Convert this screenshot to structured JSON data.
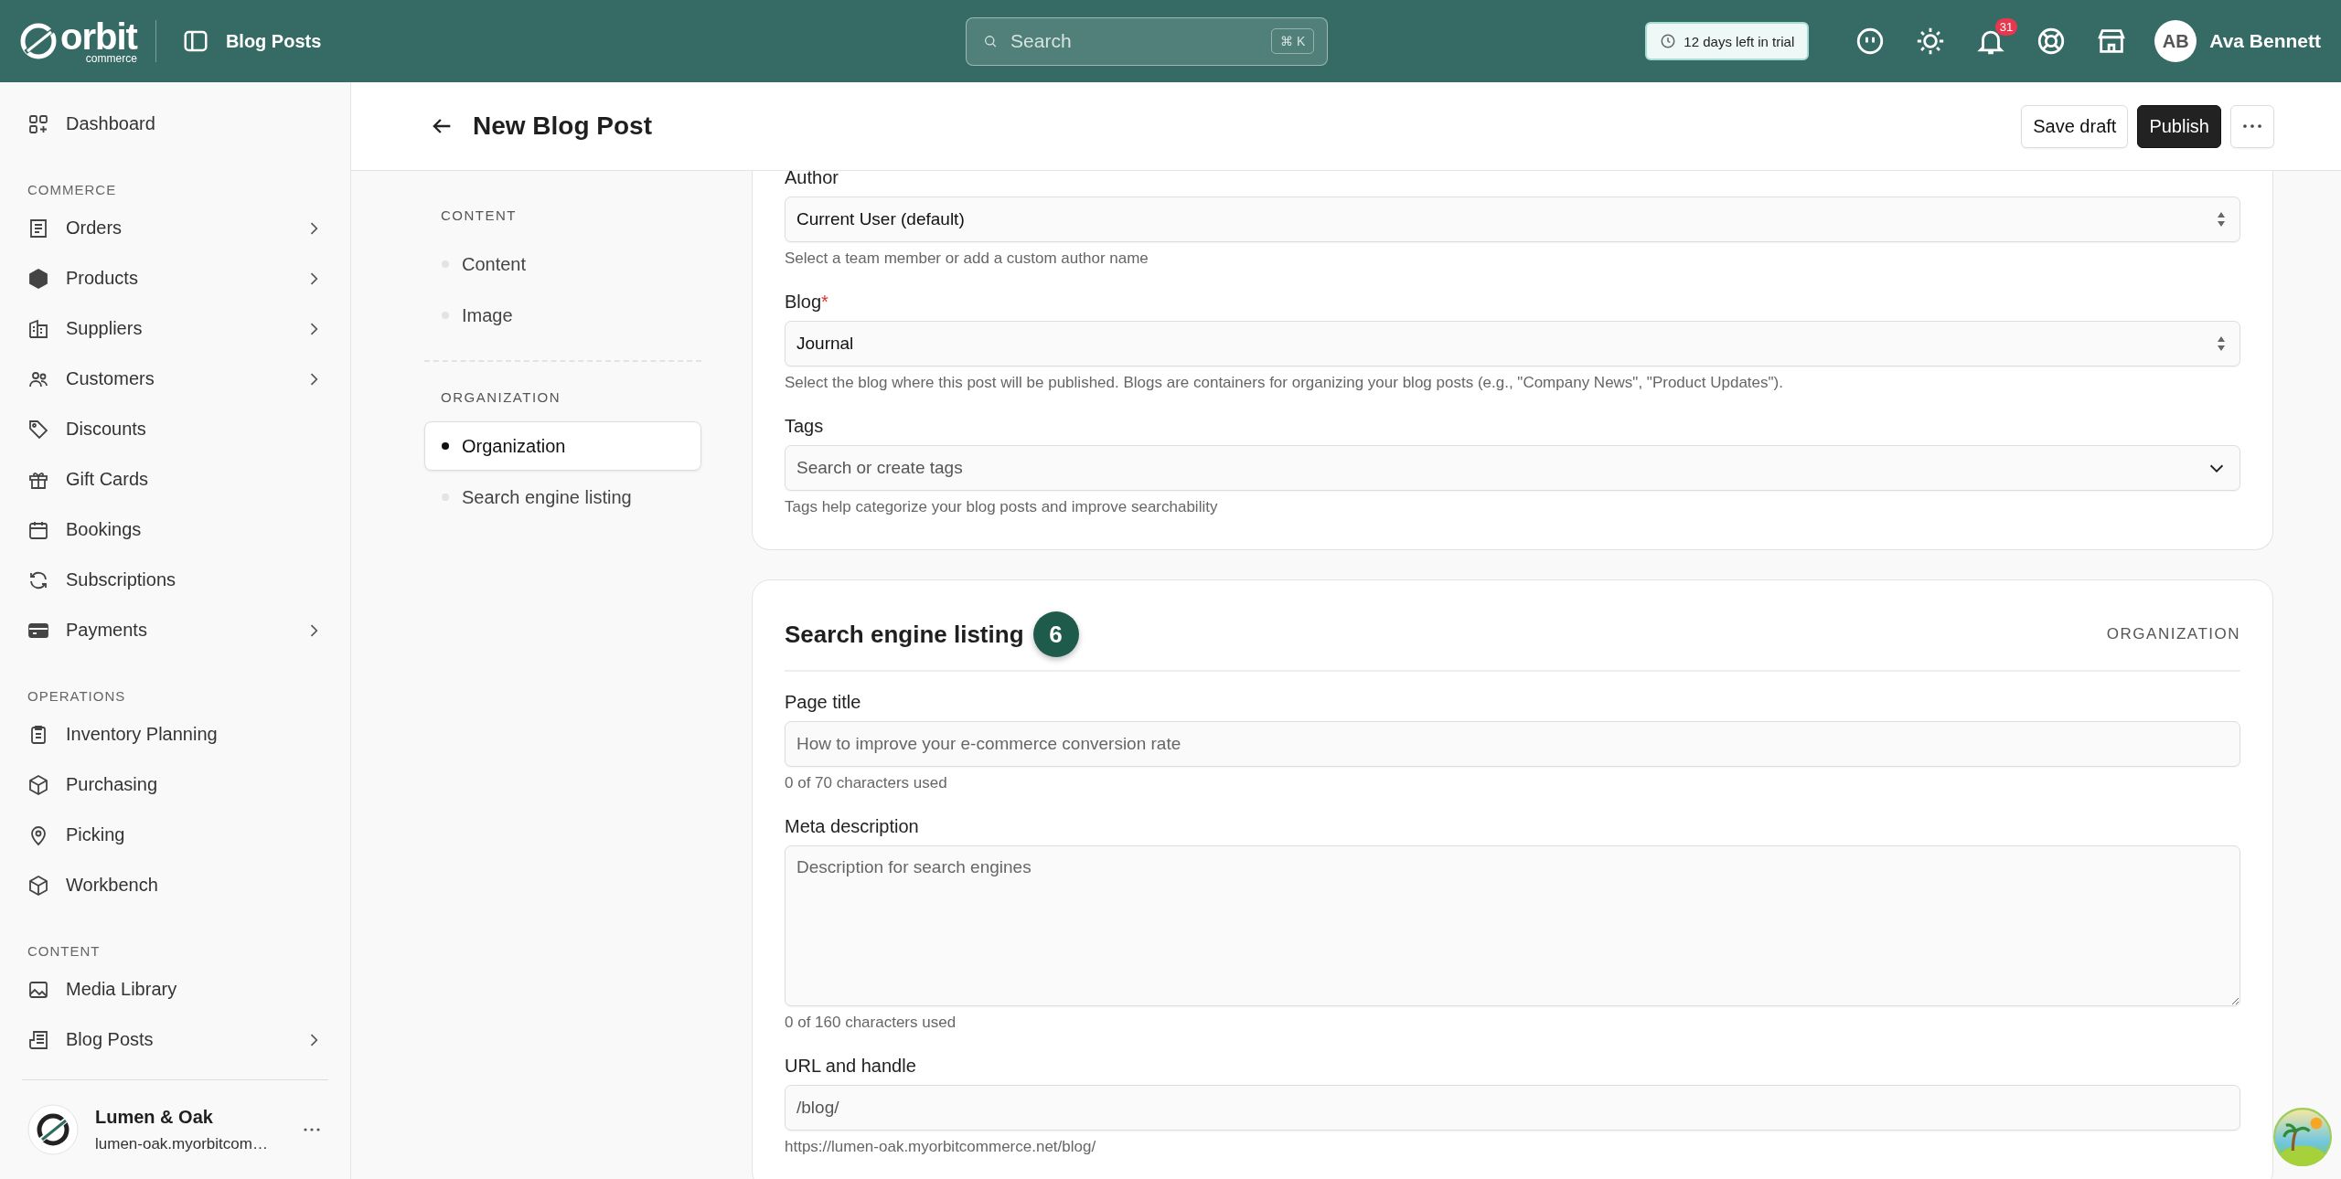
{
  "topbar": {
    "logo": {
      "word": "orbit",
      "sub": "commerce"
    },
    "page": "Blog Posts",
    "search": {
      "placeholder": "Search",
      "shortcut": "⌘ K"
    },
    "trial": "12 days left in trial",
    "notifications": "31",
    "user": {
      "initials": "AB",
      "name": "Ava Bennett"
    }
  },
  "sidebar": {
    "top": [
      {
        "label": "Dashboard",
        "expandable": false
      }
    ],
    "sections": [
      {
        "title": "COMMERCE",
        "items": [
          {
            "label": "Orders",
            "expandable": true
          },
          {
            "label": "Products",
            "expandable": true
          },
          {
            "label": "Suppliers",
            "expandable": true
          },
          {
            "label": "Customers",
            "expandable": true
          },
          {
            "label": "Discounts",
            "expandable": false
          },
          {
            "label": "Gift Cards",
            "expandable": false
          },
          {
            "label": "Bookings",
            "expandable": false
          },
          {
            "label": "Subscriptions",
            "expandable": false
          },
          {
            "label": "Payments",
            "expandable": true
          }
        ]
      },
      {
        "title": "OPERATIONS",
        "items": [
          {
            "label": "Inventory Planning",
            "expandable": false
          },
          {
            "label": "Purchasing",
            "expandable": false
          },
          {
            "label": "Picking",
            "expandable": false
          },
          {
            "label": "Workbench",
            "expandable": false
          }
        ]
      },
      {
        "title": "CONTENT",
        "items": [
          {
            "label": "Media Library",
            "expandable": false
          },
          {
            "label": "Blog Posts",
            "expandable": true
          }
        ]
      }
    ],
    "store": {
      "name": "Lumen & Oak",
      "domain": "lumen-oak.myorbitcom…"
    }
  },
  "header": {
    "title": "New Blog Post",
    "buttons": [
      {
        "label": "Save draft",
        "kind": "secondary"
      },
      {
        "label": "Publish",
        "kind": "primary"
      }
    ]
  },
  "section_nav": [
    {
      "title": "CONTENT",
      "items": [
        {
          "label": "Content",
          "selected": false
        },
        {
          "label": "Image",
          "selected": false
        }
      ]
    },
    {
      "title": "ORGANIZATION",
      "items": [
        {
          "label": "Organization",
          "selected": true
        },
        {
          "label": "Search engine listing",
          "selected": false
        }
      ]
    }
  ],
  "cards": [
    {
      "fields": [
        {
          "label": "Author",
          "kind": "select",
          "value": "Current User (default)",
          "help": "Select a team member or add a custom author name"
        },
        {
          "label": "Blog",
          "required_mark": "*",
          "kind": "select",
          "value": "Journal",
          "help": "Select the blog where this post will be published. Blogs are containers for organizing your blog posts (e.g., \"Company News\", \"Product Updates\")."
        },
        {
          "label": "Tags",
          "kind": "combobox",
          "placeholder": "Search or create tags",
          "help": "Tags help categorize your blog posts and improve searchability"
        }
      ]
    },
    {
      "title": "Search engine listing",
      "step": "6",
      "section": "ORGANIZATION",
      "fields": [
        {
          "label": "Page title",
          "kind": "text",
          "placeholder": "How to improve your e-commerce conversion rate",
          "help": "0 of 70 characters used"
        },
        {
          "label": "Meta description",
          "kind": "textarea",
          "placeholder": "Description for search engines",
          "help": "0 of 160 characters used"
        },
        {
          "label": "URL and handle",
          "kind": "text",
          "value": "/blog/",
          "help": "https://lumen-oak.myorbitcommerce.net/blog/"
        }
      ]
    }
  ]
}
